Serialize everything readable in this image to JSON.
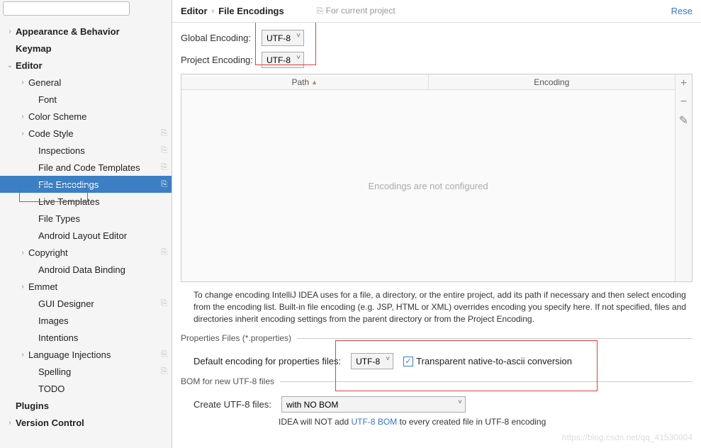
{
  "search": {
    "placeholder": ""
  },
  "sidebar": {
    "items": [
      {
        "label": "Appearance & Behavior",
        "indent": 0,
        "arrow": ">",
        "bold": true
      },
      {
        "label": "Keymap",
        "indent": 0,
        "arrow": "",
        "bold": true
      },
      {
        "label": "Editor",
        "indent": 0,
        "arrow": "v",
        "bold": true
      },
      {
        "label": "General",
        "indent": 1,
        "arrow": ">"
      },
      {
        "label": "Font",
        "indent": 2,
        "arrow": ""
      },
      {
        "label": "Color Scheme",
        "indent": 1,
        "arrow": ">"
      },
      {
        "label": "Code Style",
        "indent": 1,
        "arrow": ">",
        "copy": true
      },
      {
        "label": "Inspections",
        "indent": 2,
        "arrow": "",
        "copy": true
      },
      {
        "label": "File and Code Templates",
        "indent": 2,
        "arrow": "",
        "copy": true
      },
      {
        "label": "File Encodings",
        "indent": 2,
        "arrow": "",
        "copy": true,
        "selected": true
      },
      {
        "label": "Live Templates",
        "indent": 2,
        "arrow": ""
      },
      {
        "label": "File Types",
        "indent": 2,
        "arrow": ""
      },
      {
        "label": "Android Layout Editor",
        "indent": 2,
        "arrow": ""
      },
      {
        "label": "Copyright",
        "indent": 1,
        "arrow": ">",
        "copy": true
      },
      {
        "label": "Android Data Binding",
        "indent": 2,
        "arrow": ""
      },
      {
        "label": "Emmet",
        "indent": 1,
        "arrow": ">"
      },
      {
        "label": "GUI Designer",
        "indent": 2,
        "arrow": "",
        "copy": true
      },
      {
        "label": "Images",
        "indent": 2,
        "arrow": ""
      },
      {
        "label": "Intentions",
        "indent": 2,
        "arrow": ""
      },
      {
        "label": "Language Injections",
        "indent": 1,
        "arrow": ">",
        "copy": true
      },
      {
        "label": "Spelling",
        "indent": 2,
        "arrow": "",
        "copy": true
      },
      {
        "label": "TODO",
        "indent": 2,
        "arrow": ""
      },
      {
        "label": "Plugins",
        "indent": 0,
        "arrow": "",
        "bold": true
      },
      {
        "label": "Version Control",
        "indent": 0,
        "arrow": ">",
        "bold": true
      }
    ]
  },
  "breadcrumb": {
    "a": "Editor",
    "b": "File Encodings",
    "hint": "For current project",
    "reset": "Rese"
  },
  "form": {
    "globalLabel": "Global Encoding:",
    "globalValue": "UTF-8",
    "projectLabel": "Project Encoding:",
    "projectValue": "UTF-8"
  },
  "table": {
    "col1": "Path",
    "col2": "Encoding",
    "empty": "Encodings are not configured"
  },
  "desc": "To change encoding IntelliJ IDEA uses for a file, a directory, or the entire project, add its path if necessary and then select encoding from the encoding list. Built-in file encoding (e.g. JSP, HTML or XML) overrides encoding you specify here. If not specified, files and directories inherit encoding settings from the parent directory or from the Project Encoding.",
  "props": {
    "legend": "Properties Files (*.properties)",
    "label": "Default encoding for properties files:",
    "value": "UTF-8",
    "chkLabel": "Transparent native-to-ascii conversion"
  },
  "bom": {
    "legend": "BOM for new UTF-8 files",
    "label": "Create UTF-8 files:",
    "value": "with NO BOM",
    "note1": "IDEA will NOT add ",
    "noteLink": "UTF-8 BOM",
    "note2": " to every created file in UTF-8 encoding"
  },
  "watermark": "https://blog.csdn.net/qq_41530004"
}
